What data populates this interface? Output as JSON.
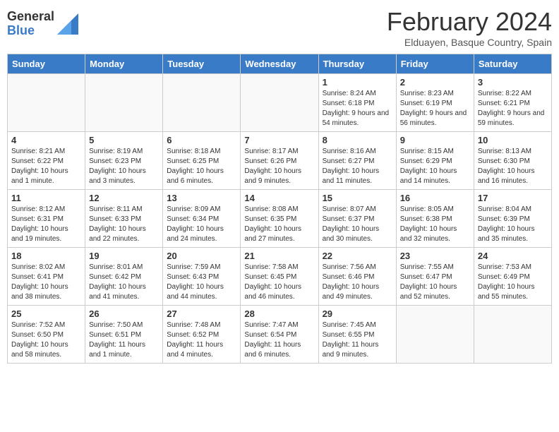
{
  "header": {
    "logo_general": "General",
    "logo_blue": "Blue",
    "title": "February 2024",
    "subtitle": "Elduayen, Basque Country, Spain"
  },
  "weekdays": [
    "Sunday",
    "Monday",
    "Tuesday",
    "Wednesday",
    "Thursday",
    "Friday",
    "Saturday"
  ],
  "weeks": [
    [
      {
        "day": "",
        "info": ""
      },
      {
        "day": "",
        "info": ""
      },
      {
        "day": "",
        "info": ""
      },
      {
        "day": "",
        "info": ""
      },
      {
        "day": "1",
        "info": "Sunrise: 8:24 AM\nSunset: 6:18 PM\nDaylight: 9 hours and 54 minutes."
      },
      {
        "day": "2",
        "info": "Sunrise: 8:23 AM\nSunset: 6:19 PM\nDaylight: 9 hours and 56 minutes."
      },
      {
        "day": "3",
        "info": "Sunrise: 8:22 AM\nSunset: 6:21 PM\nDaylight: 9 hours and 59 minutes."
      }
    ],
    [
      {
        "day": "4",
        "info": "Sunrise: 8:21 AM\nSunset: 6:22 PM\nDaylight: 10 hours and 1 minute."
      },
      {
        "day": "5",
        "info": "Sunrise: 8:19 AM\nSunset: 6:23 PM\nDaylight: 10 hours and 3 minutes."
      },
      {
        "day": "6",
        "info": "Sunrise: 8:18 AM\nSunset: 6:25 PM\nDaylight: 10 hours and 6 minutes."
      },
      {
        "day": "7",
        "info": "Sunrise: 8:17 AM\nSunset: 6:26 PM\nDaylight: 10 hours and 9 minutes."
      },
      {
        "day": "8",
        "info": "Sunrise: 8:16 AM\nSunset: 6:27 PM\nDaylight: 10 hours and 11 minutes."
      },
      {
        "day": "9",
        "info": "Sunrise: 8:15 AM\nSunset: 6:29 PM\nDaylight: 10 hours and 14 minutes."
      },
      {
        "day": "10",
        "info": "Sunrise: 8:13 AM\nSunset: 6:30 PM\nDaylight: 10 hours and 16 minutes."
      }
    ],
    [
      {
        "day": "11",
        "info": "Sunrise: 8:12 AM\nSunset: 6:31 PM\nDaylight: 10 hours and 19 minutes."
      },
      {
        "day": "12",
        "info": "Sunrise: 8:11 AM\nSunset: 6:33 PM\nDaylight: 10 hours and 22 minutes."
      },
      {
        "day": "13",
        "info": "Sunrise: 8:09 AM\nSunset: 6:34 PM\nDaylight: 10 hours and 24 minutes."
      },
      {
        "day": "14",
        "info": "Sunrise: 8:08 AM\nSunset: 6:35 PM\nDaylight: 10 hours and 27 minutes."
      },
      {
        "day": "15",
        "info": "Sunrise: 8:07 AM\nSunset: 6:37 PM\nDaylight: 10 hours and 30 minutes."
      },
      {
        "day": "16",
        "info": "Sunrise: 8:05 AM\nSunset: 6:38 PM\nDaylight: 10 hours and 32 minutes."
      },
      {
        "day": "17",
        "info": "Sunrise: 8:04 AM\nSunset: 6:39 PM\nDaylight: 10 hours and 35 minutes."
      }
    ],
    [
      {
        "day": "18",
        "info": "Sunrise: 8:02 AM\nSunset: 6:41 PM\nDaylight: 10 hours and 38 minutes."
      },
      {
        "day": "19",
        "info": "Sunrise: 8:01 AM\nSunset: 6:42 PM\nDaylight: 10 hours and 41 minutes."
      },
      {
        "day": "20",
        "info": "Sunrise: 7:59 AM\nSunset: 6:43 PM\nDaylight: 10 hours and 44 minutes."
      },
      {
        "day": "21",
        "info": "Sunrise: 7:58 AM\nSunset: 6:45 PM\nDaylight: 10 hours and 46 minutes."
      },
      {
        "day": "22",
        "info": "Sunrise: 7:56 AM\nSunset: 6:46 PM\nDaylight: 10 hours and 49 minutes."
      },
      {
        "day": "23",
        "info": "Sunrise: 7:55 AM\nSunset: 6:47 PM\nDaylight: 10 hours and 52 minutes."
      },
      {
        "day": "24",
        "info": "Sunrise: 7:53 AM\nSunset: 6:49 PM\nDaylight: 10 hours and 55 minutes."
      }
    ],
    [
      {
        "day": "25",
        "info": "Sunrise: 7:52 AM\nSunset: 6:50 PM\nDaylight: 10 hours and 58 minutes."
      },
      {
        "day": "26",
        "info": "Sunrise: 7:50 AM\nSunset: 6:51 PM\nDaylight: 11 hours and 1 minute."
      },
      {
        "day": "27",
        "info": "Sunrise: 7:48 AM\nSunset: 6:52 PM\nDaylight: 11 hours and 4 minutes."
      },
      {
        "day": "28",
        "info": "Sunrise: 7:47 AM\nSunset: 6:54 PM\nDaylight: 11 hours and 6 minutes."
      },
      {
        "day": "29",
        "info": "Sunrise: 7:45 AM\nSunset: 6:55 PM\nDaylight: 11 hours and 9 minutes."
      },
      {
        "day": "",
        "info": ""
      },
      {
        "day": "",
        "info": ""
      }
    ]
  ]
}
